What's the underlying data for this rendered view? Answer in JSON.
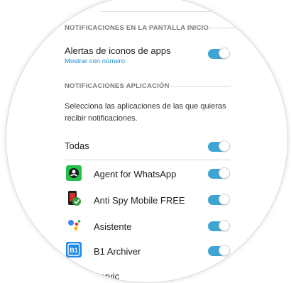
{
  "home_screen_section": {
    "header": "NOTIFICACIONES EN LA PANTALLA INICIO",
    "badges_row": {
      "title": "Alertas de iconos de apps",
      "subtitle": "Mostrar con número",
      "enabled": true
    }
  },
  "app_section": {
    "header": "NOTIFICACIONES APLICACIÓN",
    "description": "Selecciona las aplicaciones de las que quieras recibir notificaciones.",
    "all_row": {
      "label": "Todas",
      "enabled": true
    },
    "apps": [
      {
        "name": "Agent for WhatsApp",
        "icon": "agent-whatsapp-icon",
        "enabled": true
      },
      {
        "name": "Anti Spy Mobile FREE",
        "icon": "anti-spy-icon",
        "enabled": true
      },
      {
        "name": "Asistente",
        "icon": "google-assistant-icon",
        "enabled": true
      },
      {
        "name": "B1 Archiver",
        "icon": "b1-archiver-icon",
        "enabled": true
      },
      {
        "name": "Servic",
        "icon": "generic-app-icon",
        "enabled": true
      }
    ]
  },
  "colors": {
    "toggle_on": "#3ea5d3",
    "link": "#1e88c9",
    "section_header": "#7a7a7a"
  }
}
